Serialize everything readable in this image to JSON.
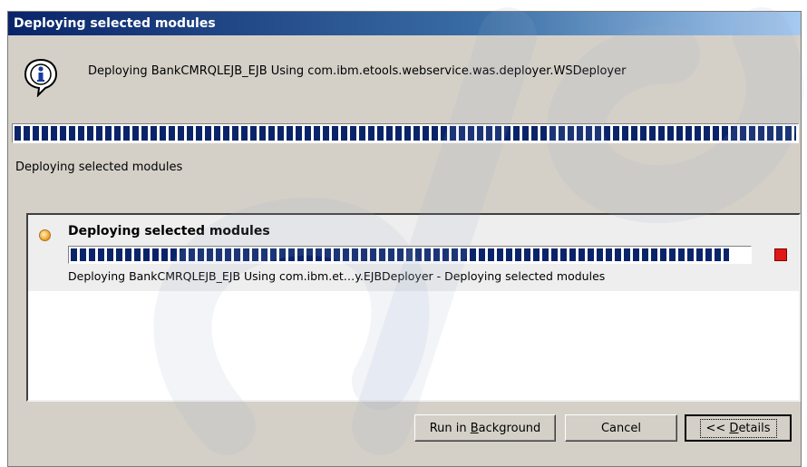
{
  "dialog": {
    "title": "Deploying selected modules",
    "message": "Deploying BankCMRQLEJB_EJB Using com.ibm.etools.webservice.was.deployer.WSDeployer",
    "progress": 1.0,
    "status_text": "Deploying selected modules"
  },
  "job": {
    "title": "Deploying selected modules",
    "progress": 0.97,
    "detail": "Deploying BankCMRQLEJB_EJB Using com.ibm.et…y.EJBDeployer - Deploying selected modules"
  },
  "buttons": {
    "run_background": {
      "prefix": "Run in ",
      "mnemonic": "B",
      "suffix": "ackground"
    },
    "cancel": "Cancel",
    "details": {
      "prefix": "<< ",
      "mnemonic": "D",
      "suffix": "etails"
    }
  },
  "icons": {
    "info": "info-icon",
    "job_status": "job-running-icon",
    "job_cancel": "stop-icon"
  },
  "colors": {
    "title_bar": "#0a246a",
    "progress_fill": "#0a246a",
    "stop": "#e01818"
  }
}
